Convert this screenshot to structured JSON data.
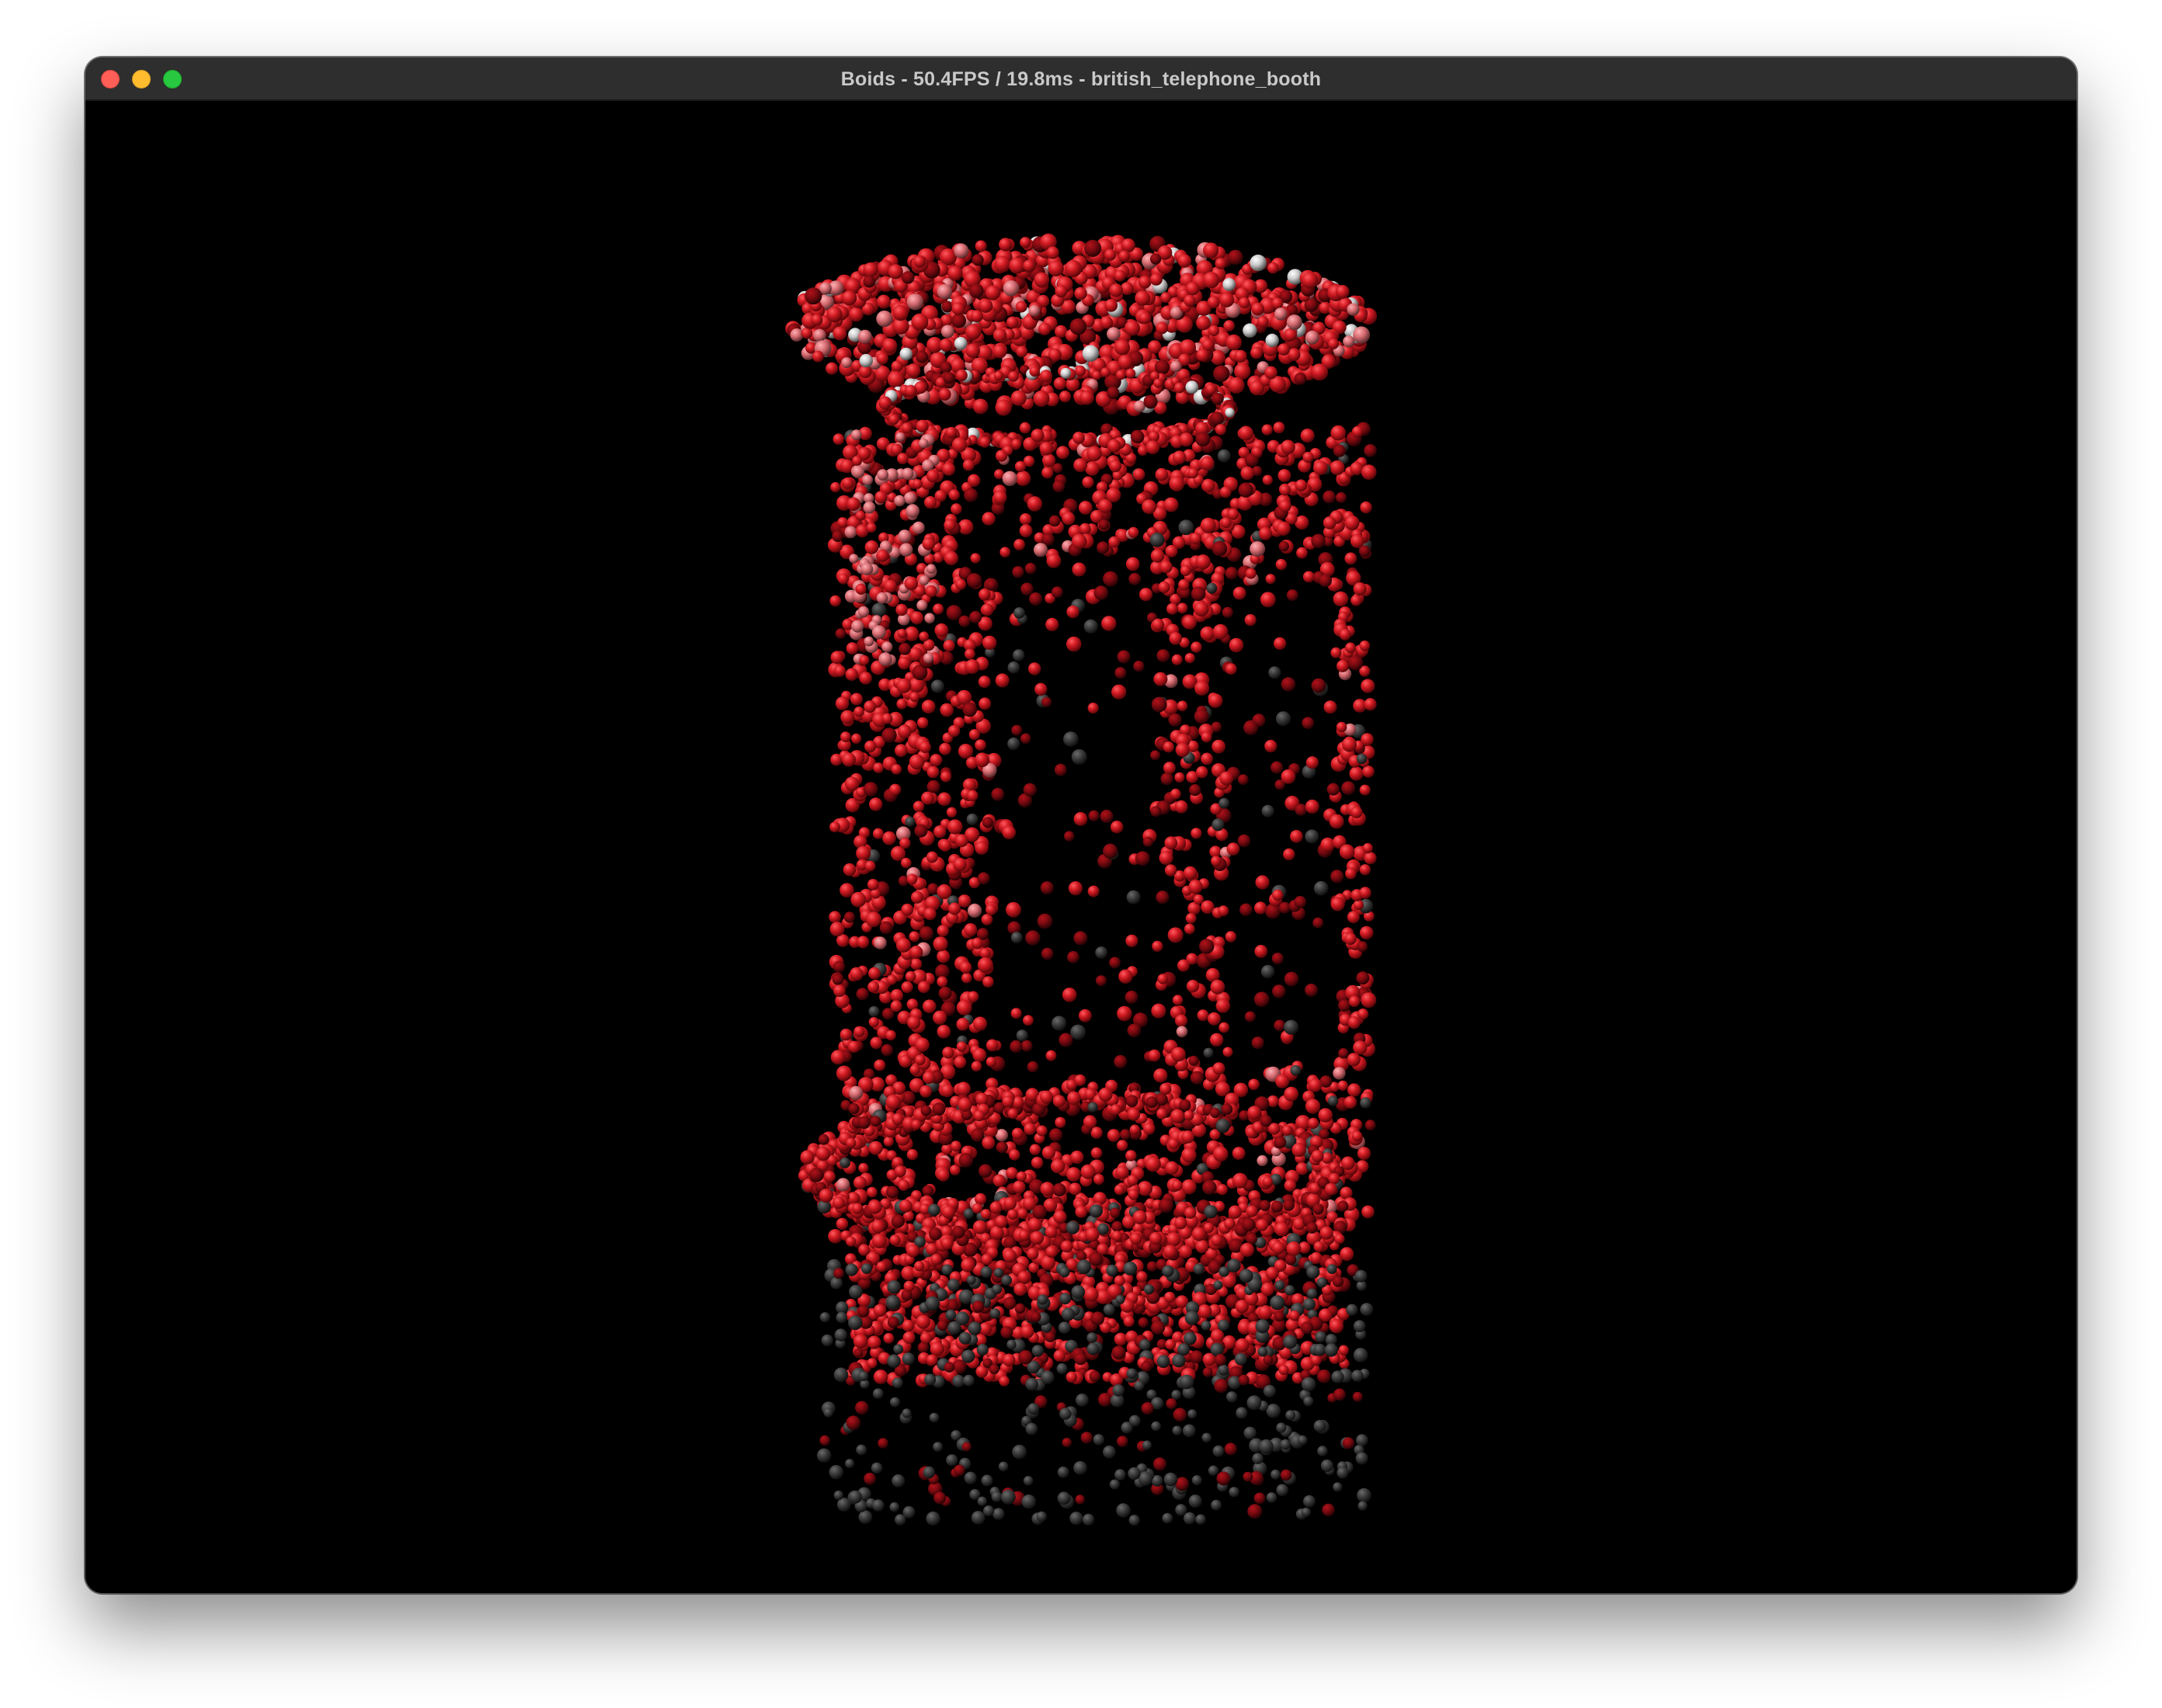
{
  "window": {
    "title": "Boids - 50.4FPS / 19.8ms - british_telephone_booth",
    "buttons": [
      "close-button",
      "minimize-button",
      "zoom-button"
    ]
  },
  "scene": {
    "background_color": "#000000",
    "boid_color": "#d11a22",
    "highlight_color": "#e0e0e0",
    "shadow_color": "#2a2a2a"
  }
}
